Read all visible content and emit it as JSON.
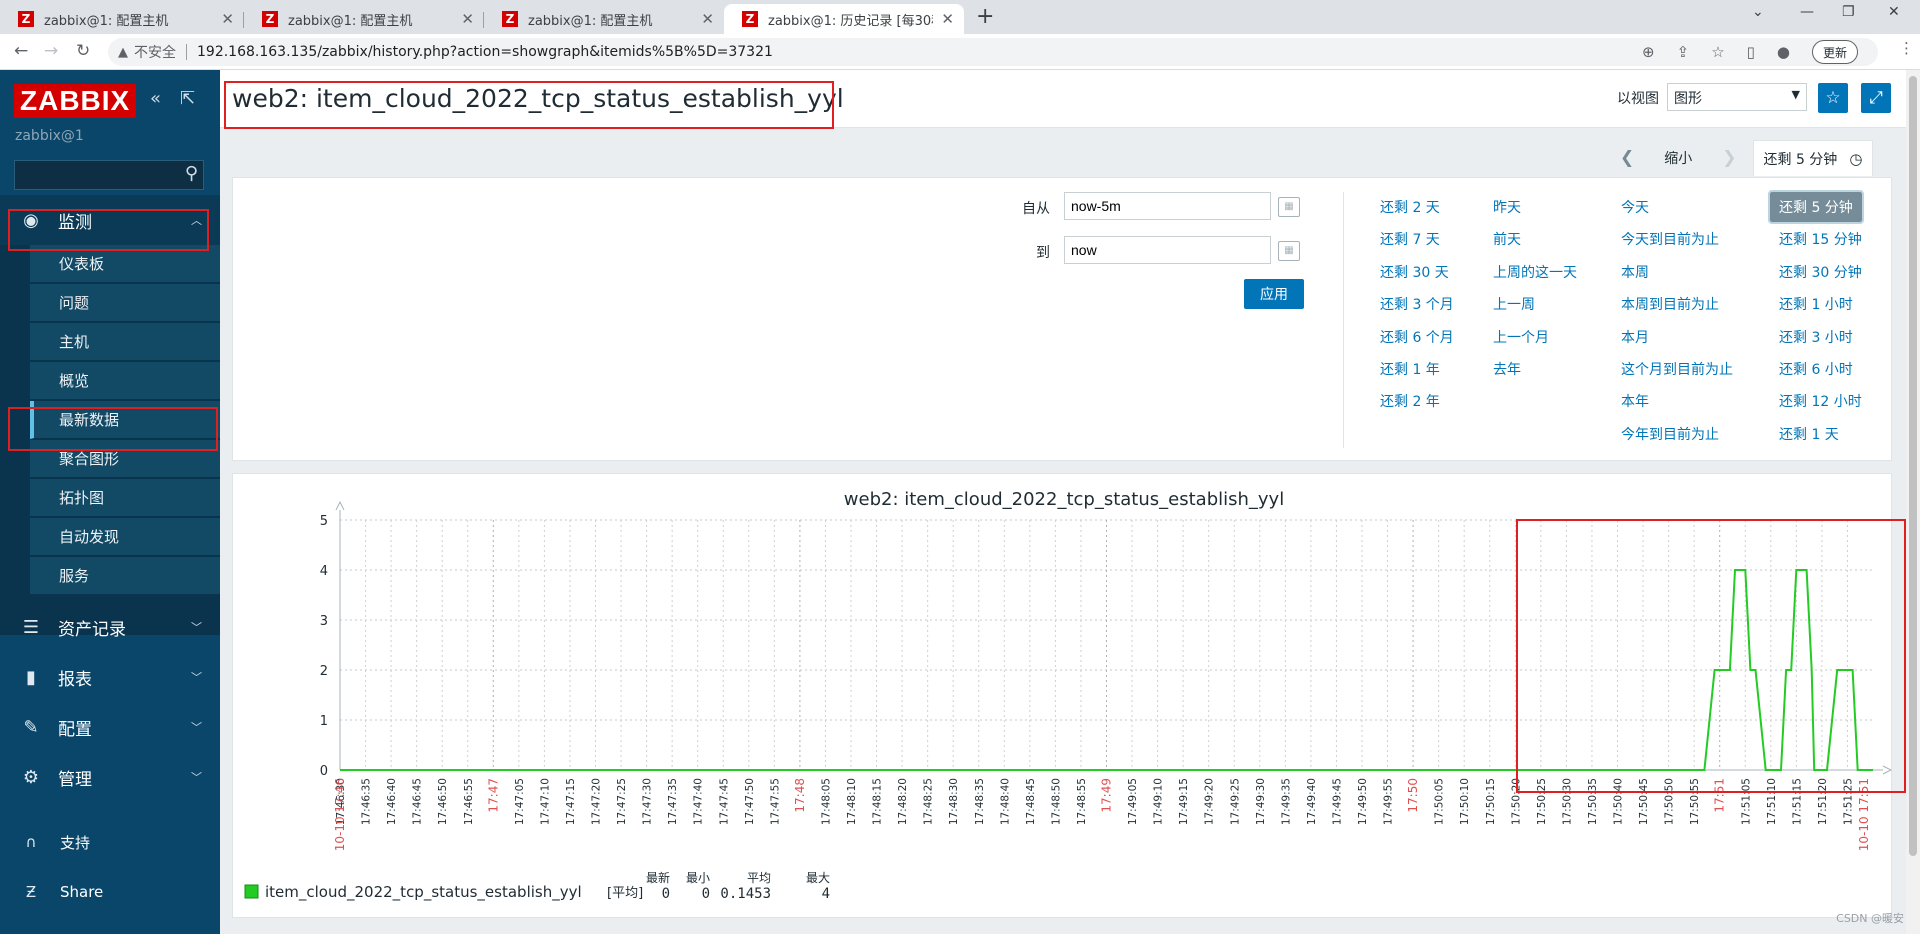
{
  "browser": {
    "tabs": [
      {
        "title": "zabbix@1: 配置主机"
      },
      {
        "title": "zabbix@1: 配置主机"
      },
      {
        "title": "zabbix@1: 配置主机"
      },
      {
        "title": "zabbix@1: 历史记录 [每30秒刷"
      }
    ],
    "insecure_label": "不安全",
    "url": "192.168.163.135/zabbix/history.php?action=showgraph&itemids%5B%5D=37321",
    "update_label": "更新"
  },
  "sidebar": {
    "logo": "ZABBIX",
    "user": "zabbix@1",
    "monitoring": "监测",
    "submenu": [
      "仪表板",
      "问题",
      "主机",
      "概览",
      "最新数据",
      "聚合图形",
      "拓扑图",
      "自动发现",
      "服务"
    ],
    "sections": [
      "资产记录",
      "报表",
      "配置",
      "管理"
    ],
    "footer": [
      "支持",
      "Share"
    ]
  },
  "header": {
    "title": "web2: item_cloud_2022_tcp_status_establish_yyl",
    "view_as_label": "以视图",
    "view_as_value": "图形"
  },
  "timebar": {
    "zoom_out": "缩小",
    "range": "还剩 5 分钟"
  },
  "filter": {
    "from_label": "自从",
    "from_value": "now-5m",
    "to_label": "到",
    "to_value": "now",
    "apply": "应用",
    "quick_ranges": [
      [
        "还剩 2 天",
        "还剩 7 天",
        "还剩 30 天",
        "还剩 3 个月",
        "还剩 6 个月",
        "还剩 1 年",
        "还剩 2 年"
      ],
      [
        "昨天",
        "前天",
        "上周的这一天",
        "上一周",
        "上一个月",
        "去年"
      ],
      [
        "今天",
        "今天到目前为止",
        "本周",
        "本周到目前为止",
        "本月",
        "这个月到目前为止",
        "本年",
        "今年到目前为止"
      ],
      [
        "还剩 5 分钟",
        "还剩 15 分钟",
        "还剩 30 分钟",
        "还剩 1 小时",
        "还剩 3 小时",
        "还剩 6 小时",
        "还剩 12 小时",
        "还剩 1 天"
      ]
    ]
  },
  "chart_data": {
    "type": "line",
    "title": "web2: item_cloud_2022_tcp_status_establish_yyl",
    "ylim": [
      0,
      5
    ],
    "yticks": [
      0,
      1,
      2,
      3,
      4,
      5
    ],
    "xlim": [
      "17:46:30",
      "17:51:30"
    ],
    "grid": true,
    "x_start_label": "10-10 17:46",
    "x_end_label": "10-10 17:51",
    "x_major_labels": [
      "17:47",
      "17:48",
      "17:49",
      "17:50",
      "17:51"
    ],
    "x_minor_labels": [
      "17:46:30",
      "17:46:35",
      "17:46:40",
      "17:46:45",
      "17:46:50",
      "17:46:55",
      "17:47:05",
      "17:47:10",
      "17:47:15",
      "17:47:20",
      "17:47:25",
      "17:47:30",
      "17:47:35",
      "17:47:40",
      "17:47:45",
      "17:47:50",
      "17:47:55",
      "17:48:05",
      "17:48:10",
      "17:48:15",
      "17:48:20",
      "17:48:25",
      "17:48:30",
      "17:48:35",
      "17:48:40",
      "17:48:45",
      "17:48:50",
      "17:48:55",
      "17:49:05",
      "17:49:10",
      "17:49:15",
      "17:49:20",
      "17:49:25",
      "17:49:30",
      "17:49:35",
      "17:49:40",
      "17:49:45",
      "17:49:50",
      "17:49:55",
      "17:50:05",
      "17:50:10",
      "17:50:15",
      "17:50:20",
      "17:50:25",
      "17:50:30",
      "17:50:35",
      "17:50:40",
      "17:50:45",
      "17:50:50",
      "17:50:55",
      "17:51:05",
      "17:51:10",
      "17:51:15",
      "17:51:20",
      "17:51:25"
    ],
    "series": [
      {
        "name": "item_cloud_2022_tcp_status_establish_yyl",
        "color": "#22cc22",
        "points": [
          [
            "17:46:30",
            0
          ],
          [
            "17:50:57",
            0
          ],
          [
            "17:50:59",
            2
          ],
          [
            "17:51:02",
            2
          ],
          [
            "17:51:03",
            4
          ],
          [
            "17:51:05",
            4
          ],
          [
            "17:51:06",
            2
          ],
          [
            "17:51:07",
            2
          ],
          [
            "17:51:09",
            0
          ],
          [
            "17:51:12",
            0
          ],
          [
            "17:51:13",
            2
          ],
          [
            "17:51:14",
            2
          ],
          [
            "17:51:15",
            4
          ],
          [
            "17:51:17",
            4
          ],
          [
            "17:51:18",
            2
          ],
          [
            "17:51:18.5",
            0
          ],
          [
            "17:51:21",
            0
          ],
          [
            "17:51:22",
            1
          ],
          [
            "17:51:23",
            2
          ],
          [
            "17:51:26",
            2
          ],
          [
            "17:51:27",
            0
          ],
          [
            "17:51:30",
            0
          ]
        ]
      }
    ],
    "legend": {
      "name": "item_cloud_2022_tcp_status_establish_yyl",
      "func": "[平均]",
      "headers": [
        "最新",
        "最小",
        "平均",
        "最大"
      ],
      "values": [
        "0",
        "0",
        "0.1453",
        "4"
      ]
    }
  },
  "watermark": "CSDN @暖安"
}
